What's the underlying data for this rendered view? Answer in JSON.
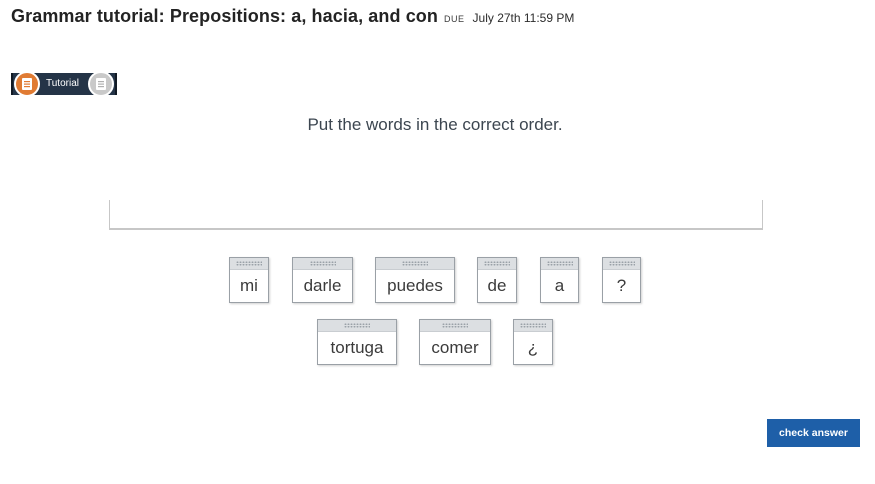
{
  "header": {
    "title": "Grammar tutorial: Prepositions: a, hacia, and con",
    "due_label": "DUE",
    "due_date": "July 27th 11:59 PM"
  },
  "progress": {
    "active_step_label": "Tutorial",
    "active_icon": "notebook-icon",
    "next_icon": "document-icon",
    "active_color": "#e07b33"
  },
  "instruction": "Put the words in the correct order.",
  "word_bank": {
    "row1": [
      "mi",
      "darle",
      "puedes",
      "de",
      "a",
      "?"
    ],
    "row2": [
      "tortuga",
      "comer",
      "¿"
    ]
  },
  "actions": {
    "check_answer": "check answer",
    "button_color": "#1e5fa8"
  }
}
